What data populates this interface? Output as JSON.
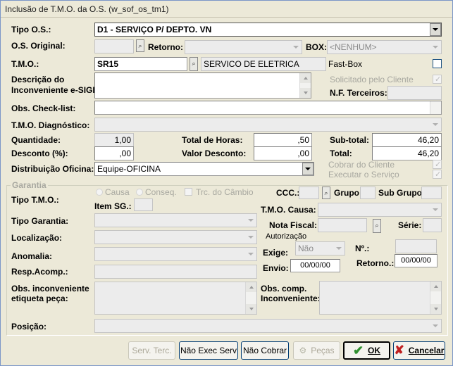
{
  "window": {
    "title": "Inclusão de T.M.O. da O.S. (w_sof_os_tm1)"
  },
  "form": {
    "tipo_os_label": "Tipo O.S.:",
    "tipo_os_value": "D1 - SERVIÇO P/ DEPTO. VN",
    "os_original_label": "O.S. Original:",
    "retorno_label": "Retorno:",
    "box_label": "BOX:",
    "box_value": "<NENHUM>",
    "tmo_label": "T.M.O.:",
    "tmo_code": "SR15",
    "tmo_desc": "SERVICO DE ELETRICA",
    "fastbox_label": "Fast-Box",
    "descricao_label_1": "Descrição do",
    "descricao_label_2": "Inconveniente e-SIGI",
    "solicitado_label": "Solicitado pelo Cliente",
    "nf_terceiros_label": "N.F. Terceiros:",
    "obs_checklist_label": "Obs. Check-list:",
    "tmo_diagnostico_label": "T.M.O. Diagnóstico:",
    "quantidade_label": "Quantidade:",
    "quantidade_value": "1,00",
    "total_horas_label": "Total de Horas:",
    "total_horas_value": ",50",
    "subtotal_label": "Sub-total:",
    "subtotal_value": "46,20",
    "desconto_label": "Desconto (%):",
    "desconto_value": ",00",
    "valor_desconto_label": "Valor Desconto:",
    "valor_desconto_value": ",00",
    "total_label": "Total:",
    "total_value": "46,20",
    "distribuicao_label": "Distribuição Oficina:",
    "distribuicao_value": "Equipe-OFICINA",
    "cobrar_label": "Cobrar do Cliente",
    "executar_label": "Executar o Serviço"
  },
  "garantia": {
    "group_label": "Garantia",
    "tipo_tmo_label": "Tipo T.M.O.:",
    "causa_label": "Causa",
    "conseq_label": "Conseq.",
    "trc_cambio_label": "Trc. do Câmbio",
    "item_sg_label": "Item SG.:",
    "ccc_label": "CCC.:",
    "grupo_label": "Grupo:",
    "sub_grupo_label": "Sub Grupo:",
    "tipo_garantia_label": "Tipo Garantia:",
    "tmo_causa_label": "T.M.O. Causa:",
    "localizacao_label": "Localização:",
    "nota_fiscal_label": "Nota Fiscal:",
    "serie_label": "Série:",
    "autorizacao_label": "Autorização",
    "anomalia_label": "Anomalia:",
    "exige_label": "Exige:",
    "exige_value": "Não",
    "numero_label": "Nº.:",
    "resp_acomp_label": "Resp.Acomp.:",
    "envio_label": "Envio:",
    "envio_value": "00/00/00",
    "retorno_label": "Retorno.:",
    "retorno_value": "00/00/00",
    "obs_etiqueta_label_1": "Obs. inconveniente",
    "obs_etiqueta_label_2": "etiqueta peça:",
    "obs_comp_label_1": "Obs. comp.",
    "obs_comp_label_2": "Inconveniente:",
    "posicao_label": "Posição:"
  },
  "buttons": {
    "serv_terc": "Serv. Terc.",
    "nao_exec_serv": "Não Exec Serv",
    "nao_cobrar": "Não Cobrar",
    "pecas": "Peças",
    "ok": "OK",
    "cancelar": "Cancelar"
  },
  "colors": {
    "ok_check": "#2f8f2f",
    "cancel_x": "#c02020",
    "focus_border": "#000000"
  }
}
